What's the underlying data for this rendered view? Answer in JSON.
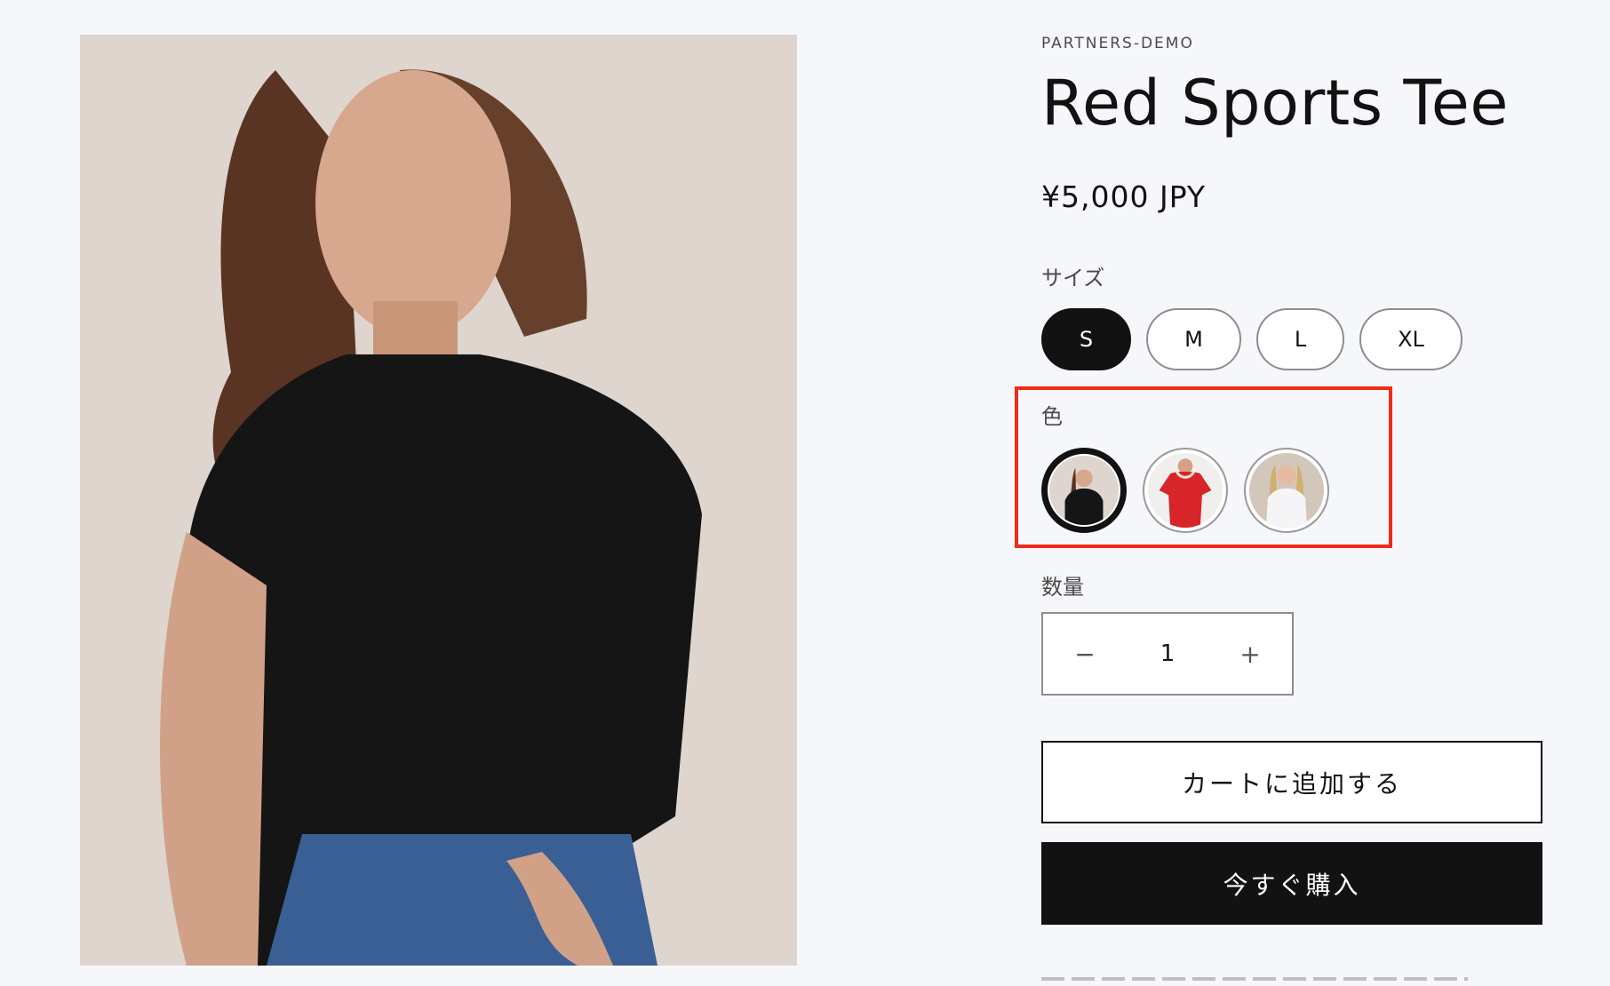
{
  "product": {
    "vendor": "PARTNERS-DEMO",
    "title": "Red Sports Tee",
    "price": "¥5,000 JPY",
    "main_image_icon": "model-black-tee-photo"
  },
  "size": {
    "label": "サイズ",
    "selected": "S",
    "options": [
      "S",
      "M",
      "L",
      "XL"
    ]
  },
  "color": {
    "label": "色",
    "selected_index": 0,
    "swatches": [
      "black-tee-thumbnail",
      "red-tee-thumbnail",
      "white-top-thumbnail"
    ],
    "highlight_color": "#f02b16"
  },
  "quantity": {
    "label": "数量",
    "value": "1",
    "decrease_symbol": "−",
    "increase_symbol": "+"
  },
  "actions": {
    "add_to_cart": "カートに追加する",
    "buy_now": "今すぐ購入"
  },
  "colors": {
    "page_background": "#f6f7fa",
    "text": "#121212",
    "highlight": "#f02b16"
  }
}
